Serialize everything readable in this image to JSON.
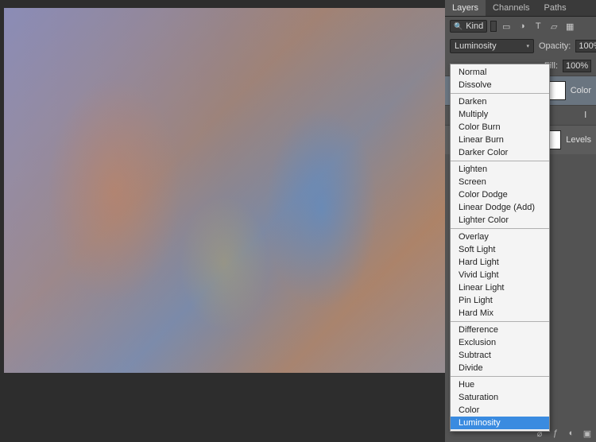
{
  "tabs": {
    "layers": "Layers",
    "channels": "Channels",
    "paths": "Paths"
  },
  "filter_kind": "Kind",
  "blend_mode": {
    "current": "Luminosity",
    "groups": [
      [
        "Normal",
        "Dissolve"
      ],
      [
        "Darken",
        "Multiply",
        "Color Burn",
        "Linear Burn",
        "Darker Color"
      ],
      [
        "Lighten",
        "Screen",
        "Color Dodge",
        "Linear Dodge (Add)",
        "Lighter Color"
      ],
      [
        "Overlay",
        "Soft Light",
        "Hard Light",
        "Vivid Light",
        "Linear Light",
        "Pin Light",
        "Hard Mix"
      ],
      [
        "Difference",
        "Exclusion",
        "Subtract",
        "Divide"
      ],
      [
        "Hue",
        "Saturation",
        "Color",
        "Luminosity"
      ]
    ],
    "highlight": "Luminosity"
  },
  "opacity": {
    "label": "Opacity:",
    "value": "100%"
  },
  "fill": {
    "label": "Fill:",
    "value": "100%"
  },
  "adjustments": [
    {
      "name": "Color",
      "sub": ""
    },
    {
      "name": "Levels",
      "sub": ""
    }
  ]
}
